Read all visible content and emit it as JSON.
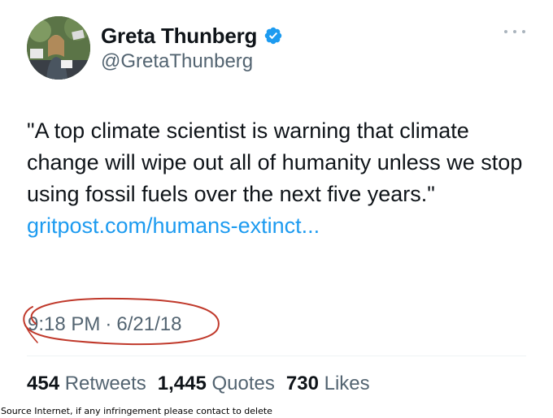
{
  "user": {
    "display_name": "Greta Thunberg",
    "handle": "@GretaThunberg",
    "verified": true
  },
  "tweet": {
    "text": "\"A top climate scientist is warning that climate change will wipe out all of humanity unless we stop using fossil fuels over the next five years.\"",
    "link": "gritpost.com/humans-extinct...",
    "time": "9:18 PM",
    "date": "6/21/18"
  },
  "stats": {
    "retweets_count": "454",
    "retweets_label": "Retweets",
    "quotes_count": "1,445",
    "quotes_label": "Quotes",
    "likes_count": "730",
    "likes_label": "Likes"
  },
  "footer": {
    "note": "Source Internet, if any infringement please contact to delete"
  },
  "colors": {
    "link": "#1d9bf0",
    "secondary_text": "#536471",
    "verified": "#1d9bf0",
    "annotation_ink": "#c0392b"
  },
  "icons": {
    "verified": "verified-badge-icon",
    "more": "more-horizontal-icon"
  }
}
